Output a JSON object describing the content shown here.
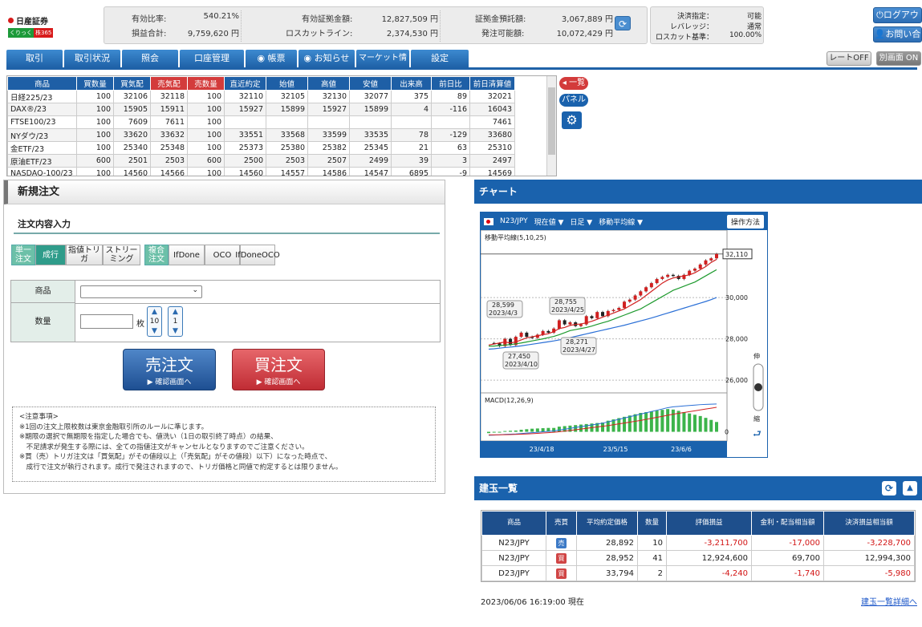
{
  "header": {
    "logo_name": "日産証券",
    "logo_sub1": "くりっく",
    "logo_sub2": "株365",
    "summary": [
      {
        "label": "有効比率:",
        "value": "540.21%"
      },
      {
        "label": "有効証拠金額:",
        "value": "12,827,509 円"
      },
      {
        "label": "証拠金預託額:",
        "value": "3,067,889 円"
      },
      {
        "label": "損益合計:",
        "value": "9,759,620 円"
      },
      {
        "label": "ロスカットライン:",
        "value": "2,374,530 円"
      },
      {
        "label": "発注可能額:",
        "value": "10,072,429 円"
      }
    ],
    "settings": [
      {
        "label": "決済指定：",
        "value": "可能"
      },
      {
        "label": "レバレッジ：",
        "value": "通常"
      },
      {
        "label": "ロスカット基準：",
        "value": "100.00%"
      }
    ],
    "logout": "ログアウト",
    "contact": "お問い合せ",
    "rate_off": "レートOFF",
    "sep_on": "別画面 ON"
  },
  "nav": [
    "取引",
    "取引状況",
    "照会",
    "口座管理",
    "帳票",
    "お知らせ",
    "マーケット情報",
    "設定"
  ],
  "market": {
    "columns": [
      "商品",
      "買数量",
      "買気配",
      "売気配",
      "売数量",
      "直近約定",
      "始値",
      "高値",
      "安値",
      "出来高",
      "前日比",
      "前日清算値"
    ],
    "rows": [
      [
        "日経225/23",
        "100",
        "32106",
        "32118",
        "100",
        "32110",
        "32105",
        "32130",
        "32077",
        "375",
        "89",
        "32021"
      ],
      [
        "DAX®/23",
        "100",
        "15905",
        "15911",
        "100",
        "15927",
        "15899",
        "15927",
        "15899",
        "4",
        "-116",
        "16043"
      ],
      [
        "FTSE100/23",
        "100",
        "7609",
        "7611",
        "100",
        "",
        "",
        "",
        "",
        "",
        "",
        "7461"
      ],
      [
        "NYダウ/23",
        "100",
        "33620",
        "33632",
        "100",
        "33551",
        "33568",
        "33599",
        "33535",
        "78",
        "-129",
        "33680"
      ],
      [
        "金ETF/23",
        "100",
        "25340",
        "25348",
        "100",
        "25373",
        "25380",
        "25382",
        "25345",
        "21",
        "63",
        "25310"
      ],
      [
        "原油ETF/23",
        "600",
        "2501",
        "2503",
        "600",
        "2500",
        "2503",
        "2507",
        "2499",
        "39",
        "3",
        "2497"
      ],
      [
        "NASDAQ-100/23",
        "100",
        "14560",
        "14566",
        "100",
        "14560",
        "14557",
        "14586",
        "14547",
        "6895",
        "-9",
        "14569"
      ]
    ],
    "side_list": "一覧",
    "side_panel": "パネル"
  },
  "order": {
    "title": "新規注文",
    "subtitle": "注文内容入力",
    "types": [
      "単一注文",
      "成行",
      "指値トリガ",
      "ストリーミング",
      "複合注文",
      "IfDone",
      "OCO",
      "IfDoneOCO"
    ],
    "product_label": "商品",
    "qty_label": "数量",
    "qty_unit": "枚",
    "step1": "10",
    "step2": "1",
    "sell": "売注文",
    "buy": "買注文",
    "confirm": "▶ 確認画面へ",
    "notes": [
      "<注意事項>",
      "※1回の注文上限枚数は東京金融取引所のルールに準じます。",
      "※期限の選択で無期限を指定した場合でも、値洗い（1日の取引終了時点）の結果、",
      "　不足請求が発生する際には、全ての指値注文がキャンセルとなりますのでご注意ください。",
      "※買（売）トリガ注文は「買気配」がその値段以上（「売気配」がその値段）以下）になった時点で、",
      "　成行で注文が執行されます。成行で発注されますので、トリガ価格と同値で約定するとは限りません。"
    ]
  },
  "chart": {
    "title": "チャート",
    "symbol": "N23/JPY",
    "price_type": "現在値",
    "period": "日足",
    "indicator": "移動平均線",
    "help": "操作方法",
    "ma_label": "移動平均線(5,10,25)",
    "macd_label": "MACD(12,26,9)",
    "y_ticks": [
      "32,110",
      "30,000",
      "28,000",
      "26,000"
    ],
    "macd_zero": "0",
    "x_ticks": [
      "23/4/18",
      "23/5/15",
      "23/6/6"
    ],
    "annotations": [
      {
        "price": "28,599",
        "date": "2023/4/3"
      },
      {
        "price": "28,755",
        "date": "2023/4/25"
      },
      {
        "price": "28,271",
        "date": "2023/4/27"
      },
      {
        "price": "27,450",
        "date": "2023/4/10"
      }
    ],
    "zoom_in": "伸",
    "zoom_out": "縮",
    "colors": {
      "up": "#d12020",
      "down": "#222222",
      "ma5": "#d12020",
      "ma10": "#1e9a2e",
      "ma25": "#2a6fd6"
    },
    "chart_data": {
      "type": "line",
      "ylim": [
        25500,
        32800
      ],
      "close": [
        27800,
        27780,
        27650,
        28000,
        27700,
        28100,
        28300,
        28100,
        28050,
        28200,
        28380,
        28300,
        28500,
        28900,
        28700,
        28800,
        28620,
        28700,
        29100,
        29000,
        29300,
        29100,
        29350,
        29400,
        29500,
        29800,
        29900,
        30100,
        30300,
        30500,
        30700,
        30900,
        31000,
        31100,
        31050,
        30900,
        31100,
        31300,
        31400,
        31600,
        31800,
        31900,
        32110
      ],
      "ma5": [
        27700,
        27750,
        27800,
        27850,
        27800,
        27850,
        27950,
        28050,
        28100,
        28150,
        28200,
        28250,
        28350,
        28500,
        28550,
        28650,
        28700,
        28720,
        28780,
        28850,
        28950,
        29050,
        29150,
        29250,
        29350,
        29450,
        29600,
        29750,
        29900,
        30100,
        30300,
        30500,
        30700,
        30850,
        30950,
        31000,
        31050,
        31100,
        31200,
        31350,
        31500,
        31700,
        31850
      ],
      "ma10": [
        27650,
        27650,
        27680,
        27700,
        27720,
        27760,
        27800,
        27850,
        27900,
        27950,
        28000,
        28060,
        28120,
        28200,
        28300,
        28400,
        28450,
        28500,
        28550,
        28620,
        28700,
        28780,
        28850,
        28950,
        29050,
        29150,
        29250,
        29350,
        29450,
        29600,
        29750,
        29900,
        30050,
        30200,
        30350,
        30450,
        30550,
        30650,
        30750,
        30900,
        31050,
        31200,
        31350
      ],
      "ma25": [
        27500,
        27520,
        27550,
        27580,
        27600,
        27630,
        27660,
        27700,
        27740,
        27780,
        27820,
        27860,
        27900,
        27950,
        28000,
        28060,
        28120,
        28180,
        28240,
        28300,
        28360,
        28420,
        28480,
        28540,
        28600,
        28660,
        28730,
        28800,
        28870,
        28940,
        29010,
        29090,
        29170,
        29250,
        29330,
        29410,
        29490,
        29570,
        29650,
        29730,
        29810,
        29900,
        30000
      ],
      "macd": [
        -40,
        -38,
        -35,
        -30,
        -28,
        -25,
        -20,
        -15,
        -10,
        -5,
        0,
        5,
        10,
        20,
        30,
        40,
        50,
        60,
        70,
        80,
        90,
        100,
        115,
        130,
        145,
        160,
        175,
        190,
        205,
        220,
        235,
        250,
        265,
        280,
        290,
        295,
        300,
        305,
        310,
        315,
        318,
        320,
        322
      ],
      "signal": [
        -35,
        -35,
        -34,
        -33,
        -32,
        -30,
        -28,
        -25,
        -22,
        -18,
        -14,
        -10,
        -5,
        0,
        8,
        16,
        24,
        32,
        40,
        48,
        56,
        64,
        72,
        82,
        92,
        102,
        112,
        122,
        132,
        144,
        156,
        168,
        180,
        192,
        204,
        214,
        224,
        234,
        244,
        254,
        264,
        274,
        284
      ]
    }
  },
  "positions": {
    "title": "建玉一覧",
    "columns": [
      "商品",
      "売買",
      "平均約定価格",
      "数量",
      "評価損益",
      "金利・配当相当額",
      "決済損益相当額"
    ],
    "rows": [
      {
        "product": "N23/JPY",
        "side": "売",
        "avg": "28,892",
        "qty": "10",
        "eval": "-3,211,700",
        "interest": "-17,000",
        "settle": "-3,228,700"
      },
      {
        "product": "N23/JPY",
        "side": "買",
        "avg": "28,952",
        "qty": "41",
        "eval": "12,924,600",
        "interest": "69,700",
        "settle": "12,994,300"
      },
      {
        "product": "D23/JPY",
        "side": "買",
        "avg": "33,794",
        "qty": "2",
        "eval": "-4,240",
        "interest": "-1,740",
        "settle": "-5,980"
      }
    ],
    "timestamp": "2023/06/06 16:19:00 現在",
    "detail_link": "建玉一覧詳細へ"
  }
}
